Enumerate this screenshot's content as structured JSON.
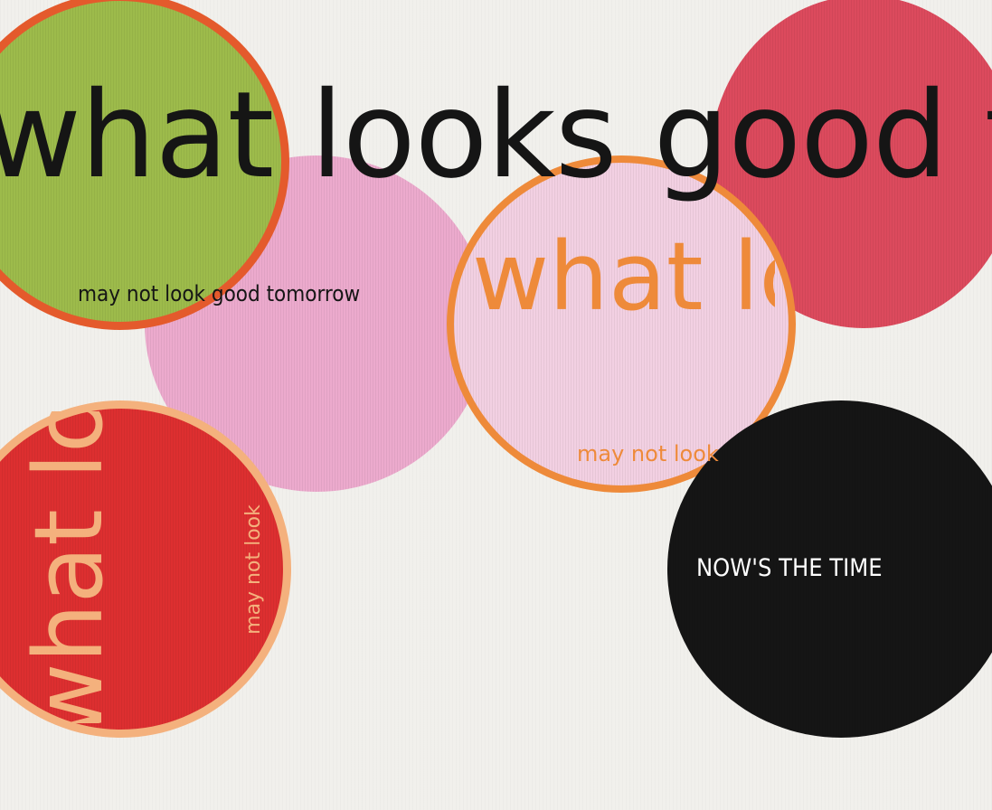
{
  "headline": "what looks good today",
  "subline_black": "may not look good tomorrow",
  "orange_circle": {
    "headline": "what lo",
    "subline": "may not look"
  },
  "red_circle": {
    "headline": "what lo",
    "subline": "may not look"
  },
  "black_circle": {
    "text": "NOW'S THE TIME"
  },
  "colors": {
    "background": "#f1f0ec",
    "green": "#9dbb4b",
    "orange_red_ring": "#e45a2c",
    "crimson": "#dc4a5d",
    "pink": "#ecaacd",
    "light_pink": "#f2d0e2",
    "orange_ring": "#ee8a3a",
    "red": "#dd2f30",
    "peach_ring": "#f4b17d",
    "black": "#151515",
    "text_dark": "#151515",
    "text_light": "#ffffff"
  }
}
